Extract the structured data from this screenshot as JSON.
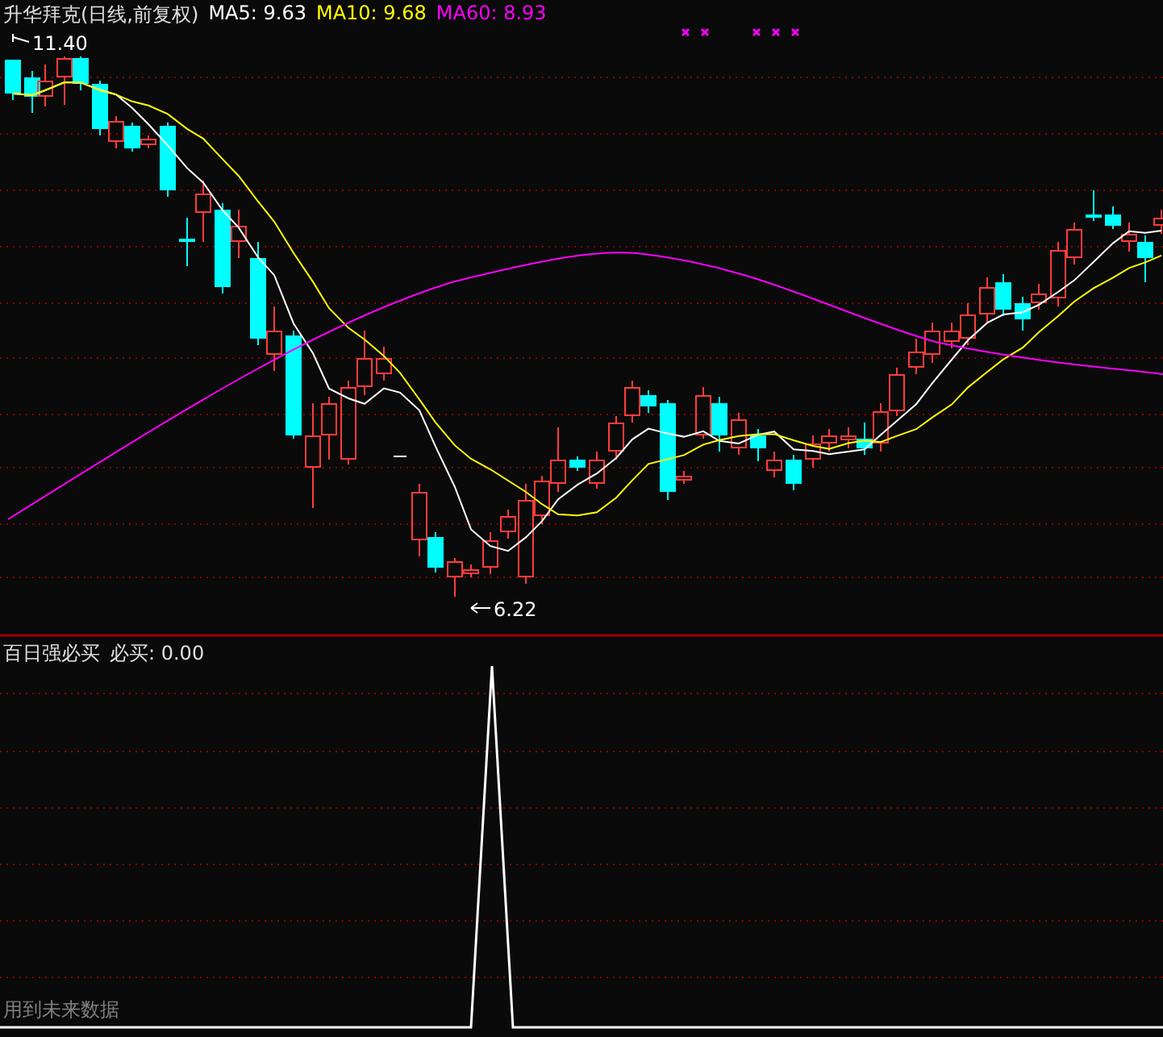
{
  "main_panel": {
    "title": "升华拜克(日线,前复权)",
    "indicators": [
      {
        "label": "MA5: 9.63",
        "color": "#ffffff"
      },
      {
        "label": "MA10: 9.68",
        "color": "#ffff00"
      },
      {
        "label": "MA60: 8.93",
        "color": "#ff00ff"
      }
    ],
    "high_label": "11.40",
    "low_label": "6.22"
  },
  "sub_panel": {
    "title": "百日强必买",
    "value_label": "必买: 0.00",
    "note": "用到未来数据"
  }
}
